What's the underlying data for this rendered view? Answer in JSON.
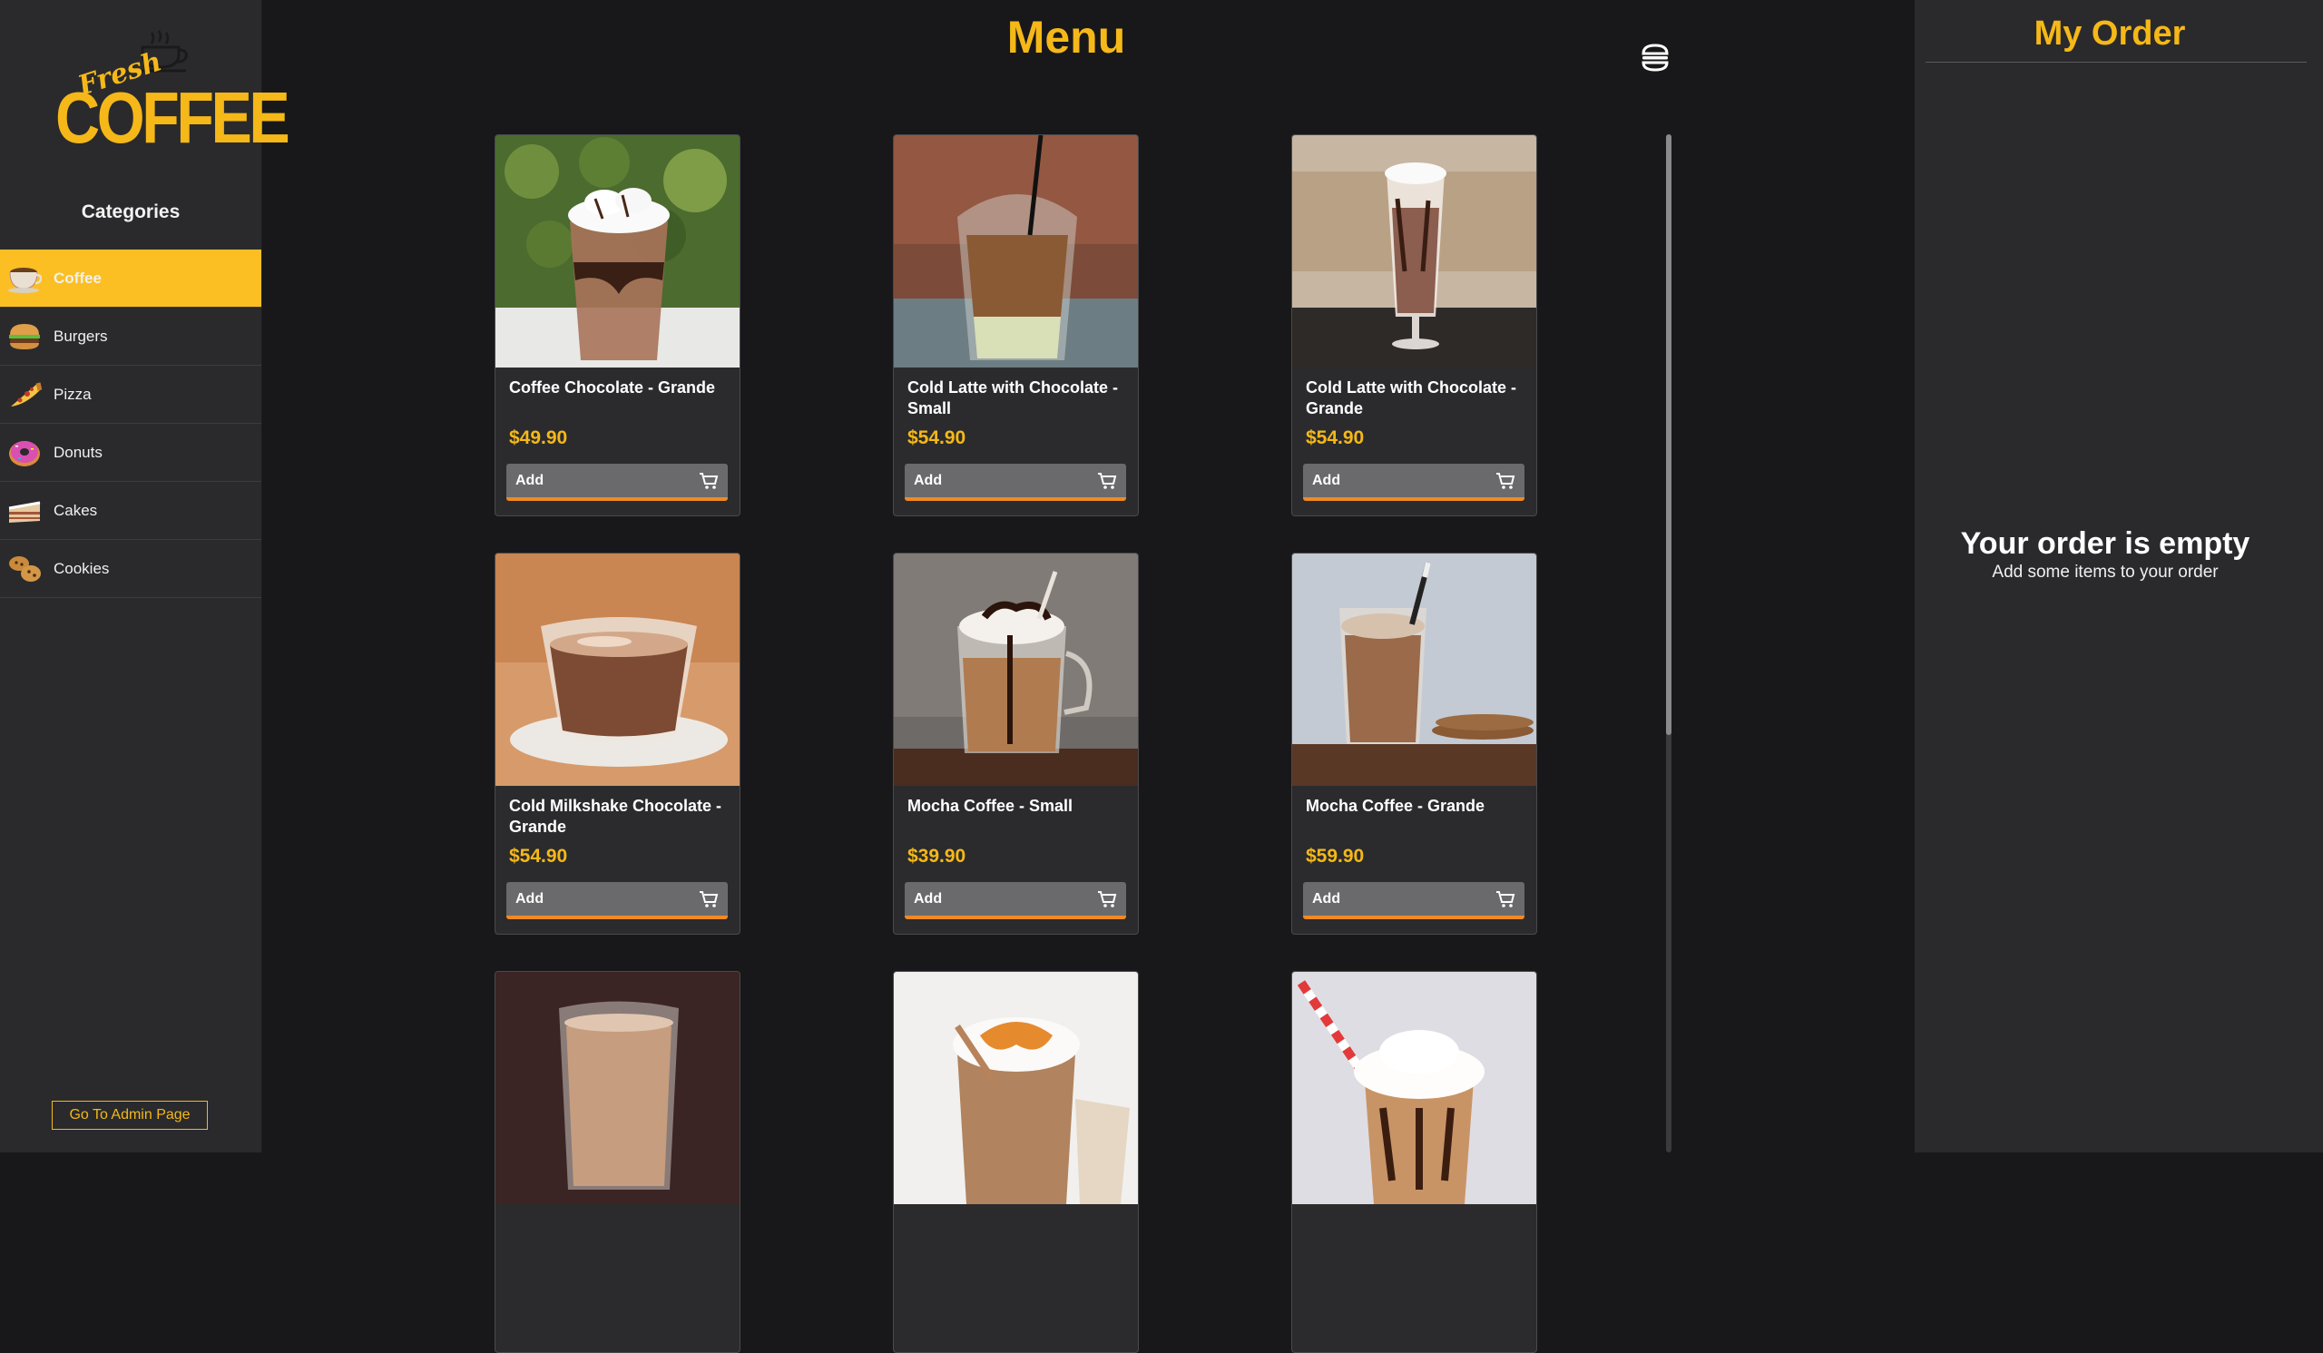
{
  "sidebar": {
    "logo_small": "Fresh",
    "logo_big": "COFFEE",
    "categories_title": "Categories",
    "categories": [
      {
        "label": "Coffee",
        "icon": "coffee-cup-icon",
        "active": true
      },
      {
        "label": "Burgers",
        "icon": "burger-icon",
        "active": false
      },
      {
        "label": "Pizza",
        "icon": "pizza-icon",
        "active": false
      },
      {
        "label": "Donuts",
        "icon": "donut-icon",
        "active": false
      },
      {
        "label": "Cakes",
        "icon": "cake-icon",
        "active": false
      },
      {
        "label": "Cookies",
        "icon": "cookie-icon",
        "active": false
      }
    ],
    "admin_button": "Go To Admin Page"
  },
  "main": {
    "title": "Menu",
    "add_label": "Add",
    "products": [
      {
        "name": "Coffee Chocolate - Grande",
        "price": "$49.90"
      },
      {
        "name": "Cold Latte with Chocolate - Small",
        "price": "$54.90"
      },
      {
        "name": "Cold Latte with Chocolate - Grande",
        "price": "$54.90"
      },
      {
        "name": "Cold Milkshake Chocolate - Grande",
        "price": "$54.90"
      },
      {
        "name": "Mocha Coffee - Small",
        "price": "$39.90"
      },
      {
        "name": "Mocha Coffee - Grande",
        "price": "$59.90"
      },
      {
        "name": "",
        "price": ""
      },
      {
        "name": "",
        "price": ""
      },
      {
        "name": "",
        "price": ""
      }
    ]
  },
  "order": {
    "title": "My Order",
    "empty_title": "Your order is empty",
    "empty_subtitle": "Add some items to your order"
  },
  "colors": {
    "accent": "#f5b818",
    "active_category": "#fbbf24",
    "button_underline": "#f08a24",
    "panel": "#2a2a2c",
    "background": "#18181a"
  }
}
